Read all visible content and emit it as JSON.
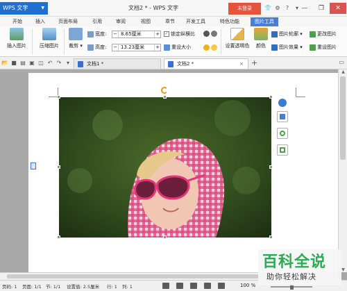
{
  "titlebar": {
    "app_button": "WPS 文字",
    "doc_title": "文档2 * - WPS 文字",
    "login_button": "未登录",
    "icons": [
      "skin-icon",
      "settings-icon",
      "help-icon",
      "arrow-icon"
    ]
  },
  "menu": {
    "tabs": [
      "开始",
      "插入",
      "页面布局",
      "引用",
      "审阅",
      "视图",
      "章节",
      "开发工具",
      "特色功能",
      "图片工具"
    ],
    "active": "图片工具"
  },
  "ribbon": {
    "insert_picture": "插入图片",
    "compress_picture": "压缩图片",
    "crop": "裁剪",
    "width_label": "宽度:",
    "width_value": "8.65厘米",
    "height_label": "高度:",
    "height_value": "13.23厘米",
    "lock_ratio": "锁定纵横比",
    "reset_size": "重设大小",
    "set_transparent": "设置透明色",
    "color": "颜色",
    "picture_outline": "图片轮廓",
    "picture_effect": "图片效果",
    "change_picture": "更改图片",
    "reset_picture": "重设图片"
  },
  "tabs": {
    "doc1": "文档1 *",
    "doc2": "文档2 *",
    "add": "+"
  },
  "status": {
    "page_num": "页码: 1",
    "page_count": "页面: 1/1",
    "section": "节: 1/1",
    "setting": "设置值: 2.5厘米",
    "row": "行: 1",
    "col": "列: 1",
    "zoom": "100 %"
  },
  "watermark": {
    "big": "百科全说",
    "small": "助你轻松解决"
  },
  "colors": {
    "accent": "#4a7ed4",
    "wps_blue": "#1f6fd1",
    "login_red": "#e5533d",
    "watermark_green": "#1fa84a"
  }
}
